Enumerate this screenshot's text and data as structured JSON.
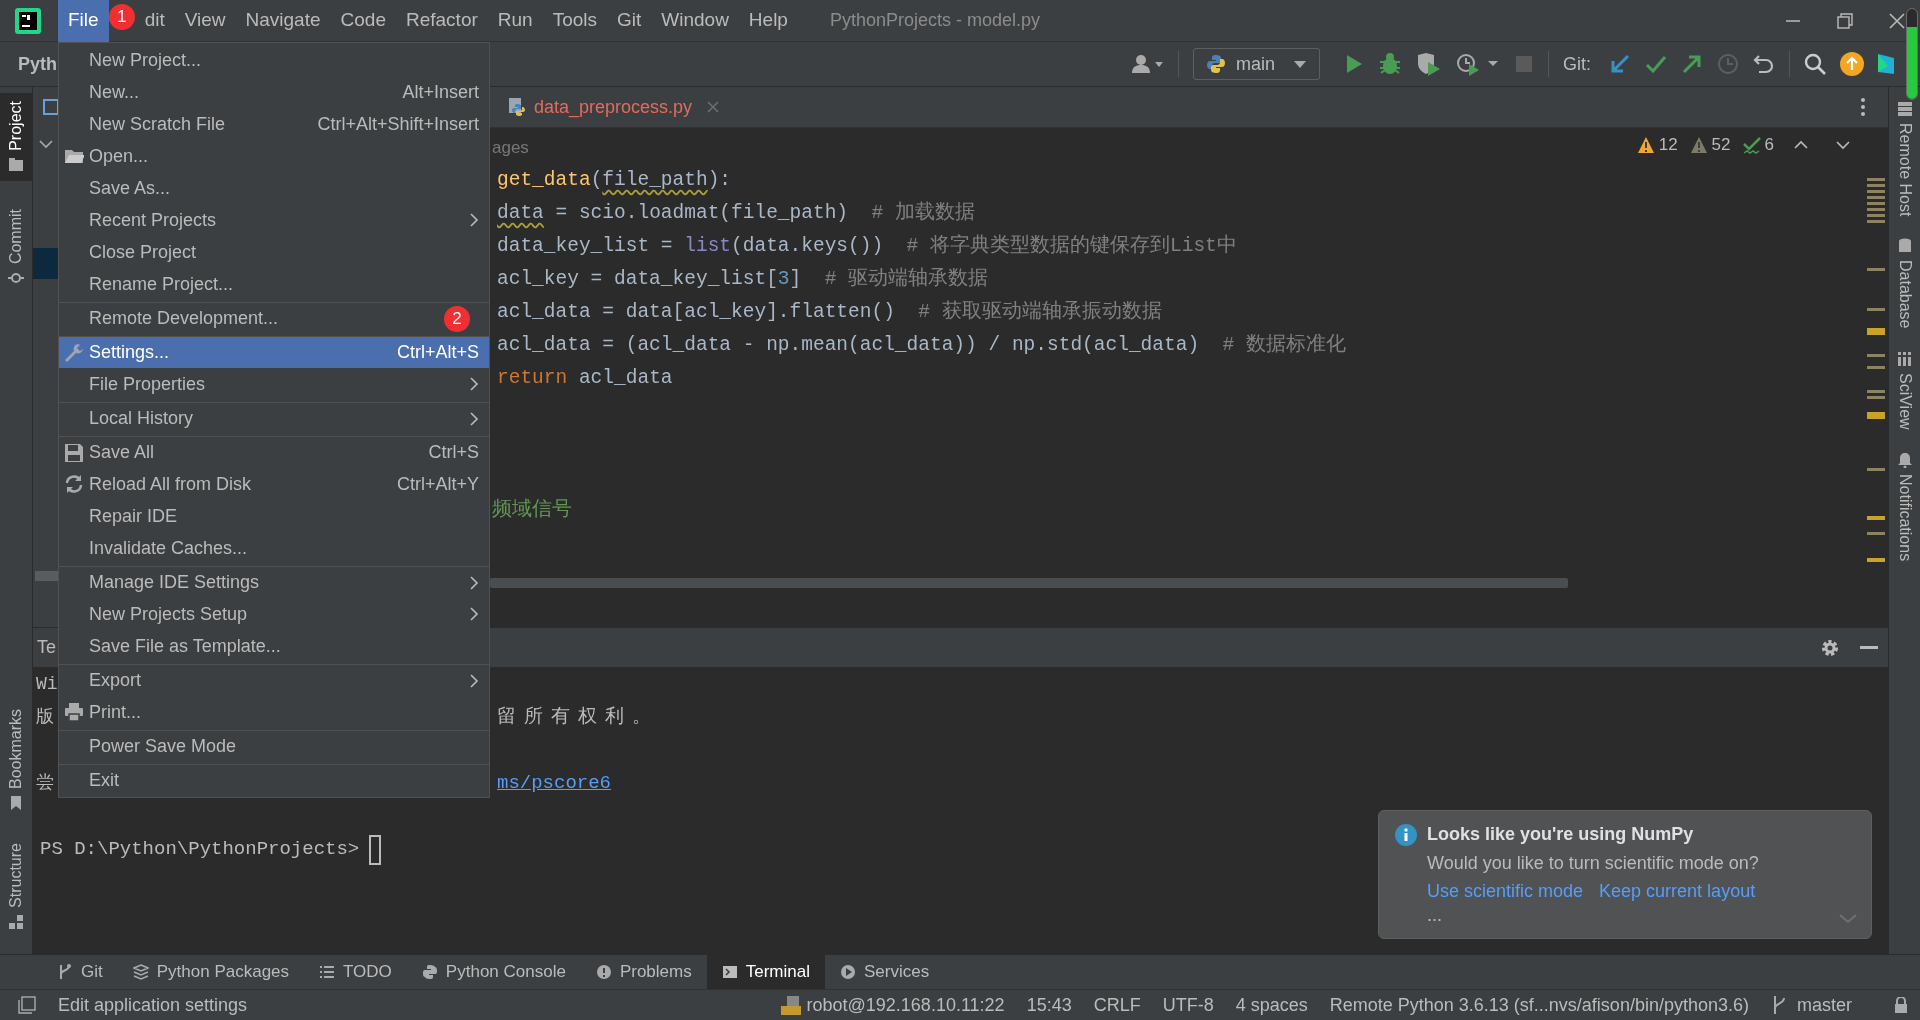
{
  "title_bar": {
    "menus": [
      {
        "label": "File",
        "selected": true
      },
      {
        "label": "dit",
        "selected": false
      },
      {
        "label": "View",
        "selected": false
      },
      {
        "label": "Navigate",
        "selected": false
      },
      {
        "label": "Code",
        "selected": false
      },
      {
        "label": "Refactor",
        "selected": false
      },
      {
        "label": "Run",
        "selected": false
      },
      {
        "label": "Tools",
        "selected": false
      },
      {
        "label": "Git",
        "selected": false
      },
      {
        "label": "Window",
        "selected": false
      },
      {
        "label": "Help",
        "selected": false
      }
    ],
    "title": "PythonProjects - model.py"
  },
  "toolbar": {
    "project": "Pyth",
    "run_config": "main",
    "git_label": "Git:"
  },
  "left_strip": [
    {
      "label": "Project",
      "selected": true
    },
    {
      "label": "Commit",
      "selected": false
    },
    {
      "label": "Bookmarks",
      "selected": false
    },
    {
      "label": "Structure",
      "selected": false
    }
  ],
  "right_strip": [
    "Remote Host",
    "Database",
    "SciView",
    "Notifications"
  ],
  "editor": {
    "tabs": [
      {
        "label": "data_preprocess.py",
        "has_errors": true
      }
    ],
    "inlay_hint": "ages",
    "inspections": [
      {
        "kind": "warning",
        "count": "12"
      },
      {
        "kind": "weak",
        "count": "52"
      },
      {
        "kind": "typo",
        "count": "6"
      }
    ],
    "lines": [
      {
        "tokens": [
          {
            "kind": "fn",
            "text": "get_data"
          },
          {
            "kind": "plain",
            "text": "("
          },
          {
            "kind": "warn",
            "text": "file_path"
          },
          {
            "kind": "plain",
            "text": "):"
          }
        ]
      },
      {
        "tokens": [
          {
            "kind": "warn",
            "text": "data"
          },
          {
            "kind": "plain",
            "text": " = scio.loadmat(file_path)  "
          },
          {
            "kind": "comment",
            "text": "# 加载数据"
          }
        ]
      },
      {
        "tokens": [
          {
            "kind": "plain",
            "text": "data_key_list = "
          },
          {
            "kind": "builtin",
            "text": "list"
          },
          {
            "kind": "plain",
            "text": "(data.keys())  "
          },
          {
            "kind": "comment",
            "text": "# 将字典类型数据的键保存到List中"
          }
        ]
      },
      {
        "tokens": [
          {
            "kind": "plain",
            "text": "acl_key = data_key_list["
          },
          {
            "kind": "number",
            "text": "3"
          },
          {
            "kind": "plain",
            "text": "]  "
          },
          {
            "kind": "comment",
            "text": "# 驱动端轴承数据"
          }
        ]
      },
      {
        "tokens": [
          {
            "kind": "plain",
            "text": "acl_data = data[acl_key].flatten()  "
          },
          {
            "kind": "comment",
            "text": "# 获取驱动端轴承振动数据"
          }
        ]
      },
      {
        "tokens": [
          {
            "kind": "plain",
            "text": "acl_data = (acl_data - np.mean(acl_data)) / np.std(acl_data)  "
          },
          {
            "kind": "comment",
            "text": "# 数据标准化"
          }
        ]
      },
      {
        "tokens": [
          {
            "kind": "keyword",
            "text": "return"
          },
          {
            "kind": "plain",
            "text": " acl_data"
          }
        ]
      }
    ],
    "docstring_fragment": "频域信号"
  },
  "file_menu": [
    {
      "label": "New Project...",
      "separator_before": false,
      "submenu": false,
      "selected": false
    },
    {
      "label": "New...",
      "shortcut": "Alt+Insert",
      "separator_before": false,
      "submenu": false,
      "selected": false
    },
    {
      "label": "New Scratch File",
      "shortcut": "Ctrl+Alt+Shift+Insert",
      "separator_before": false,
      "submenu": false,
      "selected": false
    },
    {
      "label": "Open...",
      "separator_before": false,
      "submenu": false,
      "selected": false
    },
    {
      "label": "Save As...",
      "separator_before": false,
      "submenu": false,
      "selected": false
    },
    {
      "label": "Recent Projects",
      "separator_before": false,
      "submenu": true,
      "selected": false
    },
    {
      "label": "Close Project",
      "separator_before": false,
      "submenu": false,
      "selected": false
    },
    {
      "label": "Rename Project...",
      "separator_before": false,
      "submenu": false,
      "selected": false
    },
    {
      "label": "Remote Development...",
      "separator_before": true,
      "submenu": false,
      "selected": false
    },
    {
      "label": "Settings...",
      "shortcut": "Ctrl+Alt+S",
      "separator_before": true,
      "submenu": false,
      "selected": true
    },
    {
      "label": "File Properties",
      "separator_before": false,
      "submenu": true,
      "selected": false
    },
    {
      "label": "Local History",
      "separator_before": true,
      "submenu": true,
      "selected": false
    },
    {
      "label": "Save All",
      "shortcut": "Ctrl+S",
      "separator_before": true,
      "submenu": false,
      "selected": false
    },
    {
      "label": "Reload All from Disk",
      "shortcut": "Ctrl+Alt+Y",
      "separator_before": false,
      "submenu": false,
      "selected": false
    },
    {
      "label": "Repair IDE",
      "separator_before": false,
      "submenu": false,
      "selected": false
    },
    {
      "label": "Invalidate Caches...",
      "separator_before": false,
      "submenu": false,
      "selected": false
    },
    {
      "label": "Manage IDE Settings",
      "separator_before": true,
      "submenu": true,
      "selected": false
    },
    {
      "label": "New Projects Setup",
      "separator_before": false,
      "submenu": true,
      "selected": false
    },
    {
      "label": "Save File as Template...",
      "separator_before": false,
      "submenu": false,
      "selected": false
    },
    {
      "label": "Export",
      "separator_before": true,
      "submenu": true,
      "selected": false
    },
    {
      "label": "Print...",
      "separator_before": false,
      "submenu": false,
      "selected": false
    },
    {
      "label": "Power Save Mode",
      "separator_before": true,
      "submenu": false,
      "selected": false
    },
    {
      "label": "Exit",
      "separator_before": true,
      "submenu": false,
      "selected": false
    }
  ],
  "step_badges": [
    "1",
    "2"
  ],
  "terminal": {
    "tab": "Te",
    "lines": [
      {
        "kind": "text",
        "left": "Wi"
      },
      {
        "kind": "text",
        "left": "版",
        "right": "留所有权利。"
      },
      {
        "kind": "link",
        "left": "尝",
        "right": "ms/pscore6"
      }
    ],
    "prompt": "PS D:\\Python\\PythonProjects>"
  },
  "notification": {
    "title": "Looks like you're using NumPy",
    "body": "Would you like to turn scientific mode on?",
    "actions": [
      "Use scientific mode",
      "Keep current layout"
    ],
    "more": "..."
  },
  "tool_tabs": [
    {
      "label": "Git",
      "selected": false
    },
    {
      "label": "Python Packages",
      "selected": false
    },
    {
      "label": "TODO",
      "selected": false
    },
    {
      "label": "Python Console",
      "selected": false
    },
    {
      "label": "Problems",
      "selected": false
    },
    {
      "label": "Terminal",
      "selected": true
    },
    {
      "label": "Services",
      "selected": false
    }
  ],
  "status_bar": {
    "message": "Edit application settings",
    "items": [
      "robot@192.168.10.11:22",
      "15:43",
      "CRLF",
      "UTF-8",
      "4 spaces",
      "Remote Python 3.6.13 (sf...nvs/afison/bin/python3.6)"
    ],
    "branch": "master"
  }
}
